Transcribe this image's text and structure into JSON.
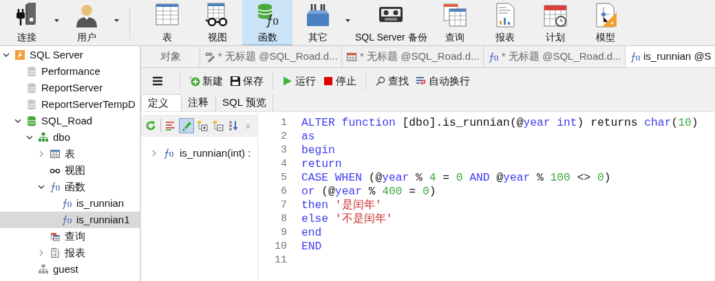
{
  "toolbar": {
    "groups": [
      [
        {
          "label": "连接",
          "kind": "connect",
          "dropdown": true,
          "selected": false
        },
        {
          "label": "用户",
          "kind": "user",
          "dropdown": true,
          "selected": false
        }
      ],
      [
        {
          "label": "表",
          "kind": "table",
          "dropdown": false,
          "selected": false
        },
        {
          "label": "视图",
          "kind": "view",
          "dropdown": false,
          "selected": false
        },
        {
          "label": "函数",
          "kind": "function",
          "dropdown": false,
          "selected": true
        },
        {
          "label": "其它",
          "kind": "other",
          "dropdown": true,
          "selected": false
        },
        {
          "label": "SQL Server 备份",
          "kind": "backup",
          "dropdown": false,
          "selected": false
        },
        {
          "label": "查询",
          "kind": "query",
          "dropdown": false,
          "selected": false
        },
        {
          "label": "报表",
          "kind": "report",
          "dropdown": false,
          "selected": false
        },
        {
          "label": "计划",
          "kind": "schedule",
          "dropdown": false,
          "selected": false
        },
        {
          "label": "模型",
          "kind": "model",
          "dropdown": false,
          "selected": false
        }
      ]
    ]
  },
  "tree": [
    {
      "label": "SQL Server",
      "kind": "server",
      "expanded": true,
      "selected": false,
      "children": [
        {
          "label": "Performance",
          "kind": "database",
          "selected": false
        },
        {
          "label": "ReportServer",
          "kind": "database",
          "selected": false
        },
        {
          "label": "ReportServerTempD",
          "kind": "database",
          "selected": false
        },
        {
          "label": "SQL_Road",
          "kind": "database-open",
          "expanded": true,
          "selected": false,
          "children": [
            {
              "label": "dbo",
              "kind": "schema",
              "expanded": true,
              "selected": false,
              "children": [
                {
                  "label": "表",
                  "kind": "tables",
                  "expanded": false,
                  "selected": false
                },
                {
                  "label": "视图",
                  "kind": "views",
                  "selected": false
                },
                {
                  "label": "函数",
                  "kind": "function",
                  "expanded": true,
                  "selected": false,
                  "children": [
                    {
                      "label": "is_runnian",
                      "kind": "function",
                      "selected": false
                    },
                    {
                      "label": "is_runnian1",
                      "kind": "function",
                      "selected": true
                    }
                  ]
                },
                {
                  "label": "查询",
                  "kind": "queries",
                  "selected": false
                },
                {
                  "label": "报表",
                  "kind": "reports",
                  "expanded": false,
                  "selected": false
                }
              ]
            },
            {
              "label": "guest",
              "kind": "schema-grey",
              "selected": false
            }
          ]
        }
      ]
    }
  ],
  "editor_tabs": [
    {
      "label": "对象",
      "kind": "objects",
      "selected": false
    },
    {
      "label": "* 无标题 @SQL_Road.d...",
      "kind": "query",
      "selected": false
    },
    {
      "label": "* 无标题 @SQL_Road.d...",
      "kind": "table",
      "selected": false
    },
    {
      "label": "* 无标题 @SQL_Road.d...",
      "kind": "function",
      "selected": false
    },
    {
      "label": "is_runnian @S",
      "kind": "function",
      "selected": true
    }
  ],
  "actions": [
    {
      "kind": "menu"
    },
    {
      "kind": "separator"
    },
    {
      "kind": "new",
      "label": "新建"
    },
    {
      "kind": "save",
      "label": "保存"
    },
    {
      "kind": "separator"
    },
    {
      "kind": "run",
      "label": "运行"
    },
    {
      "kind": "stop",
      "label": "停止"
    },
    {
      "kind": "separator"
    },
    {
      "kind": "find",
      "label": "查找"
    },
    {
      "kind": "wrap",
      "label": "自动换行"
    }
  ],
  "sub_tabs": [
    {
      "label": "定义",
      "selected": true
    },
    {
      "label": "注释",
      "selected": false
    },
    {
      "label": "SQL 预览",
      "selected": false
    }
  ],
  "outline": {
    "tools": [
      {
        "kind": "refresh",
        "selected": false
      },
      {
        "kind": "format",
        "selected": false
      },
      {
        "kind": "highlight",
        "selected": true
      },
      {
        "kind": "add",
        "selected": false
      },
      {
        "kind": "remove",
        "selected": false
      },
      {
        "kind": "sort",
        "selected": false
      }
    ],
    "close_label": "×",
    "items": [
      {
        "label": "is_runnian(int) :",
        "expanded": false
      }
    ]
  },
  "code": [
    {
      "number": "1",
      "tokens": [
        {
          "t": "ALTER function",
          "kind": "keyword"
        },
        {
          "t": " [dbo].is_runnian(@",
          "kind": "plain"
        },
        {
          "t": "year int",
          "kind": "keyword"
        },
        {
          "t": ") returns ",
          "kind": "plain"
        },
        {
          "t": "char",
          "kind": "keyword"
        },
        {
          "t": "(",
          "kind": "plain"
        },
        {
          "t": "10",
          "kind": "number"
        },
        {
          "t": ")",
          "kind": "plain"
        }
      ]
    },
    {
      "number": "2",
      "tokens": [
        {
          "t": "as",
          "kind": "keyword"
        }
      ]
    },
    {
      "number": "3",
      "tokens": [
        {
          "t": "begin",
          "kind": "keyword"
        }
      ]
    },
    {
      "number": "4",
      "tokens": [
        {
          "t": "return",
          "kind": "keyword"
        }
      ]
    },
    {
      "number": "5",
      "tokens": [
        {
          "t": "CASE WHEN",
          "kind": "keyword"
        },
        {
          "t": " (@",
          "kind": "plain"
        },
        {
          "t": "year",
          "kind": "keyword"
        },
        {
          "t": " % ",
          "kind": "plain"
        },
        {
          "t": "4",
          "kind": "number"
        },
        {
          "t": " = ",
          "kind": "plain"
        },
        {
          "t": "0",
          "kind": "number"
        },
        {
          "t": " AND",
          "kind": "keyword"
        },
        {
          "t": " @",
          "kind": "plain"
        },
        {
          "t": "year",
          "kind": "keyword"
        },
        {
          "t": " % ",
          "kind": "plain"
        },
        {
          "t": "100",
          "kind": "number"
        },
        {
          "t": " <> ",
          "kind": "plain"
        },
        {
          "t": "0",
          "kind": "number"
        },
        {
          "t": ")",
          "kind": "plain"
        }
      ]
    },
    {
      "number": "6",
      "tokens": [
        {
          "t": "or",
          "kind": "keyword"
        },
        {
          "t": " (@",
          "kind": "plain"
        },
        {
          "t": "year",
          "kind": "keyword"
        },
        {
          "t": " % ",
          "kind": "plain"
        },
        {
          "t": "400",
          "kind": "number"
        },
        {
          "t": " = ",
          "kind": "plain"
        },
        {
          "t": "0",
          "kind": "number"
        },
        {
          "t": ")",
          "kind": "plain"
        }
      ]
    },
    {
      "number": "7",
      "tokens": [
        {
          "t": "then",
          "kind": "keyword"
        },
        {
          "t": " '是闰年'",
          "kind": "string"
        }
      ]
    },
    {
      "number": "8",
      "tokens": [
        {
          "t": "else",
          "kind": "keyword"
        },
        {
          "t": " '不是闰年'",
          "kind": "string"
        }
      ]
    },
    {
      "number": "9",
      "tokens": [
        {
          "t": "end",
          "kind": "keyword"
        }
      ]
    },
    {
      "number": "10",
      "tokens": [
        {
          "t": "END",
          "kind": "keyword"
        }
      ]
    },
    {
      "number": "11"
    }
  ]
}
